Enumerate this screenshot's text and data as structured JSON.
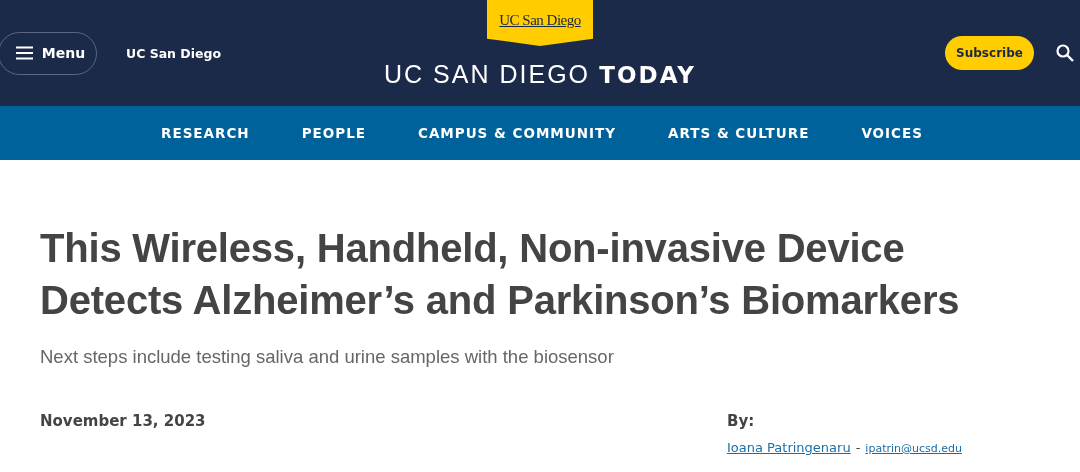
{
  "header": {
    "menu_button": "Menu",
    "site_link": "UC San Diego",
    "logo": "UC San Diego",
    "title_light": "UC SAN DIEGO",
    "title_bold": "TODAY",
    "subscribe_button": "Subscribe"
  },
  "nav": [
    "RESEARCH",
    "PEOPLE",
    "CAMPUS & COMMUNITY",
    "ARTS & CULTURE",
    "VOICES"
  ],
  "article": {
    "title": "This Wireless, Handheld, Non-invasive Device Detects Alzheimer’s and Parkinson’s Biomarkers",
    "subtitle": "Next steps include testing saliva and urine samples with the biosensor",
    "date": "November 13, 2023",
    "byline_label": "By:",
    "author": "Ioana Patringenaru",
    "separator": "-",
    "email": "ipatrin@ucsd.edu"
  }
}
